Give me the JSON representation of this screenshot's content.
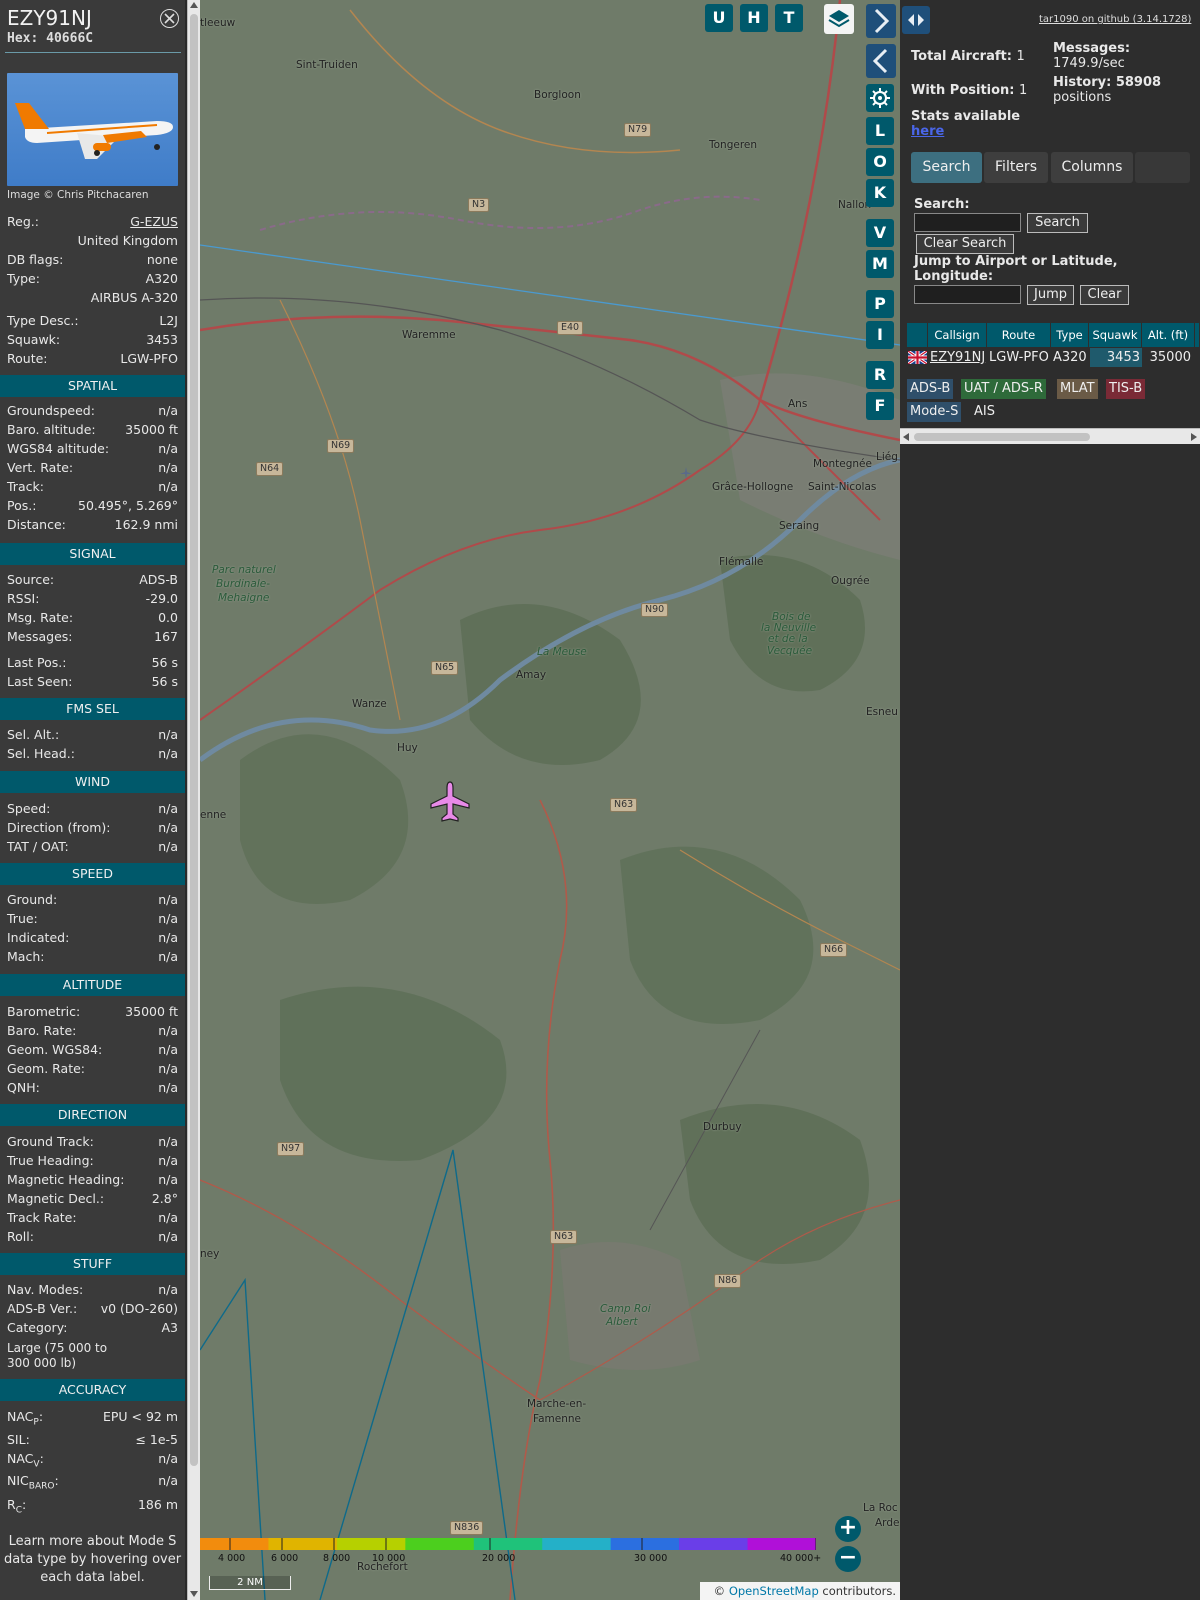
{
  "aircraft": {
    "callsign": "EZY91NJ",
    "hex": "Hex: 40666C",
    "photo_credit": "Image © Chris Pitchacaren",
    "rows_top": [
      {
        "k": "Reg.:",
        "v": "G-EZUS"
      },
      {
        "k": "",
        "v": "United Kingdom"
      },
      {
        "k": "DB flags:",
        "v": "none"
      },
      {
        "k": "Type:",
        "v": "A320"
      },
      {
        "k": "",
        "v": "AIRBUS A-320"
      },
      {
        "k": "Type Desc.:",
        "v": "L2J"
      },
      {
        "k": "Squawk:",
        "v": "3453"
      },
      {
        "k": "Route:",
        "v": "LGW-PFO"
      }
    ]
  },
  "sections": {
    "spatial": {
      "title": "SPATIAL",
      "rows": [
        {
          "k": "Groundspeed:",
          "v": "n/a"
        },
        {
          "k": "Baro. altitude:",
          "v": "35000 ft"
        },
        {
          "k": "WGS84 altitude:",
          "v": "n/a"
        },
        {
          "k": "Vert. Rate:",
          "v": "n/a"
        },
        {
          "k": "Track:",
          "v": "n/a"
        },
        {
          "k": "Pos.:",
          "v": "50.495°, 5.269°"
        },
        {
          "k": "Distance:",
          "v": "162.9 nmi"
        }
      ]
    },
    "signal": {
      "title": "SIGNAL",
      "rows": [
        {
          "k": "Source:",
          "v": "ADS-B"
        },
        {
          "k": "RSSI:",
          "v": "-29.0"
        },
        {
          "k": "Msg. Rate:",
          "v": "0.0"
        },
        {
          "k": "Messages:",
          "v": "167"
        },
        {
          "k": "Last Pos.:",
          "v": "56 s"
        },
        {
          "k": "Last Seen:",
          "v": "56 s"
        }
      ]
    },
    "fms": {
      "title": "FMS SEL",
      "rows": [
        {
          "k": "Sel. Alt.:",
          "v": "n/a"
        },
        {
          "k": "Sel. Head.:",
          "v": "n/a"
        }
      ]
    },
    "wind": {
      "title": "WIND",
      "rows": [
        {
          "k": "Speed:",
          "v": "n/a"
        },
        {
          "k": "Direction (from):",
          "v": "n/a"
        },
        {
          "k": "TAT / OAT:",
          "v": "n/a"
        }
      ]
    },
    "speed": {
      "title": "SPEED",
      "rows": [
        {
          "k": "Ground:",
          "v": "n/a"
        },
        {
          "k": "True:",
          "v": "n/a"
        },
        {
          "k": "Indicated:",
          "v": "n/a"
        },
        {
          "k": "Mach:",
          "v": "n/a"
        }
      ]
    },
    "altitude": {
      "title": "ALTITUDE",
      "rows": [
        {
          "k": "Barometric:",
          "v": "35000 ft"
        },
        {
          "k": "Baro. Rate:",
          "v": "n/a"
        },
        {
          "k": "Geom. WGS84:",
          "v": "n/a"
        },
        {
          "k": "Geom. Rate:",
          "v": "n/a"
        },
        {
          "k": "QNH:",
          "v": "n/a"
        }
      ]
    },
    "direction": {
      "title": "DIRECTION",
      "rows": [
        {
          "k": "Ground Track:",
          "v": "n/a"
        },
        {
          "k": "True Heading:",
          "v": "n/a"
        },
        {
          "k": "Magnetic Heading:",
          "v": "n/a"
        },
        {
          "k": "Magnetic Decl.:",
          "v": "2.8°"
        },
        {
          "k": "Track Rate:",
          "v": "n/a"
        },
        {
          "k": "Roll:",
          "v": "n/a"
        }
      ]
    },
    "stuff": {
      "title": "STUFF",
      "rows": [
        {
          "k": "Nav. Modes:",
          "v": "n/a"
        },
        {
          "k": "ADS-B Ver.:",
          "v": "v0 (DO-260)"
        },
        {
          "k": "Category:",
          "v": "A3"
        }
      ],
      "category_desc_1": "Large (75 000 to",
      "category_desc_2": "300 000 lb)"
    },
    "accuracy": {
      "title": "ACCURACY",
      "nacp_k": "NAC",
      "nacp_sub": "P",
      "nacp_v": "EPU < 92 m",
      "sil_k": "SIL:",
      "sil_v": "≤ 1e-5",
      "nacv_k": "NAC",
      "nacv_sub": "V",
      "nacv_v": "n/a",
      "nicbaro_k": "NIC",
      "nicbaro_sub": "BARO",
      "nicbaro_v": "n/a",
      "rc_k": "R",
      "rc_sub": "C",
      "rc_v": "186 m",
      "colon": ":"
    }
  },
  "note": {
    "line1": "Learn more about Mode S",
    "line2": "data type by hovering over",
    "line3": "each data label."
  },
  "map": {
    "buttons_top": [
      "U",
      "H",
      "T"
    ],
    "buttons_side": [
      "L",
      "O",
      "K",
      "V",
      "M",
      "P",
      "I",
      "R",
      "F"
    ],
    "zoom_in": "+",
    "zoom_out": "−",
    "scale": "2 NM",
    "attribution_pre": "© ",
    "attribution_link": "OpenStreetMap",
    "attribution_post": " contributors.",
    "alt_labels": [
      "4 000",
      "6 000",
      "8 000",
      "10 000",
      "20 000",
      "30 000",
      "40 000+"
    ],
    "alt_colors": [
      "#f28c0d",
      "#e0b400",
      "#b6d000",
      "#4ccf1e",
      "#1fc27a",
      "#24b0c8",
      "#2b6fe0",
      "#6a3ee8",
      "#b010d8"
    ],
    "places": [
      {
        "t": "tleeuw"
      },
      {
        "t": "Sint-Truiden"
      },
      {
        "t": "Borgloon"
      },
      {
        "t": "Tongeren"
      },
      {
        "t": "Waremme"
      },
      {
        "t": "Ans"
      },
      {
        "t": "Montegnée"
      },
      {
        "t": "Grâce-Hollogne"
      },
      {
        "t": "Saint-Nicolas"
      },
      {
        "t": "Seraing"
      },
      {
        "t": "Flémalle"
      },
      {
        "t": "Ougrée"
      },
      {
        "t": "Liég"
      },
      {
        "t": "Amay"
      },
      {
        "t": "Wanze"
      },
      {
        "t": "Huy"
      },
      {
        "t": "Esneu"
      },
      {
        "t": "enne"
      },
      {
        "t": "Durbuy"
      },
      {
        "t": "Marche-en-"
      },
      {
        "t": "Famenne"
      },
      {
        "t": "ney"
      },
      {
        "t": "Rochefort"
      },
      {
        "t": "La Roc"
      },
      {
        "t": "Arde"
      },
      {
        "t": "Nallon"
      }
    ],
    "places_it": [
      {
        "t": "Parc naturel"
      },
      {
        "t": "Burdinale-"
      },
      {
        "t": "Mehaigne"
      },
      {
        "t": "La Meuse"
      },
      {
        "t": "Bois de"
      },
      {
        "t": "la Neuville"
      },
      {
        "t": "et de la"
      },
      {
        "t": "Vecquée"
      },
      {
        "t": "Camp Roi"
      },
      {
        "t": "Albert"
      }
    ],
    "roads": [
      "N79",
      "N3",
      "E40",
      "N69",
      "N64",
      "N90",
      "N65",
      "N63",
      "N66",
      "N97",
      "N63",
      "N86",
      "N836"
    ]
  },
  "right": {
    "github": "tar1090 on github (3.14.1728)",
    "total_label": "Total Aircraft:",
    "total_value": "1",
    "withpos_label": "With Position:",
    "withpos_value": "1",
    "messages_label": "Messages:",
    "messages_value": "1749.9/sec",
    "history_label": "History: 58908",
    "history_value": "positions",
    "stats_label": "Stats available",
    "stats_link": "here",
    "tabs": [
      "Search",
      "Filters",
      "Columns"
    ],
    "search_label": "Search:",
    "search_button": "Search",
    "clear_search": "Clear Search",
    "jump_label_1": "Jump to Airport or Latitude,",
    "jump_label_2": "Longitude:",
    "jump_button": "Jump",
    "clear_button": "Clear",
    "table": {
      "headers": [
        "Callsign",
        "Route",
        "Type",
        "Squawk",
        "Alt. (ft)"
      ],
      "row": {
        "callsign": "EZY91NJ",
        "route": "LGW-PFO",
        "type": "A320",
        "squawk": "3453",
        "alt": "35000"
      }
    },
    "legend": [
      {
        "t": "ADS-B",
        "c": "#2f4f6a"
      },
      {
        "t": "UAT / ADS-R",
        "c": "#2e6a3a"
      },
      {
        "t": "MLAT",
        "c": "#6a5a46"
      },
      {
        "t": "TIS-B",
        "c": "#7a2a36"
      },
      {
        "t": "Mode-S",
        "c": "#2f4f6a"
      },
      {
        "t": "AIS",
        "c": "#2d2d2d"
      }
    ]
  }
}
